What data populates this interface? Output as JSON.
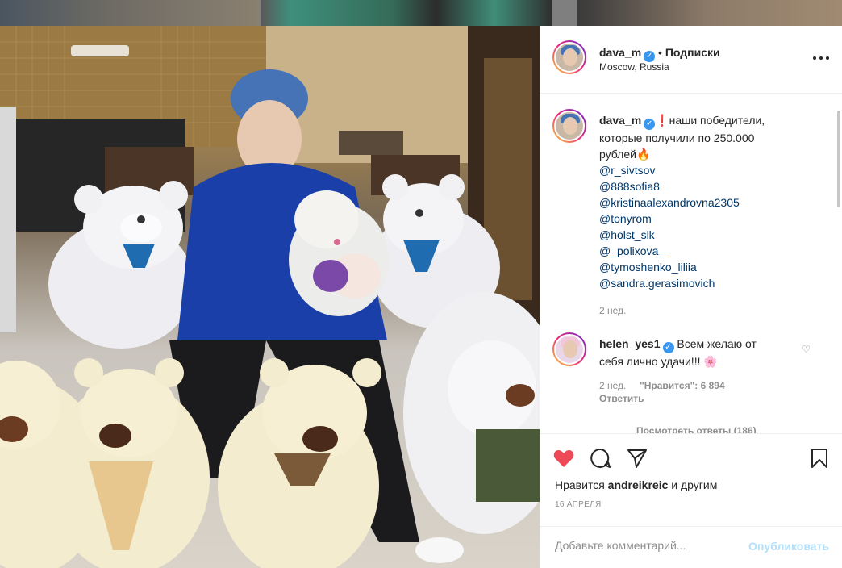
{
  "post": {
    "username": "dava_m",
    "follow_separator": "•",
    "follow_label": "Подписки",
    "location": "Moscow, Russia"
  },
  "caption": {
    "username": "dava_m",
    "text_line1": "❗наши победители,",
    "text_line2": "которые получили по 250.000",
    "text_line3": "рублей🔥",
    "mentions": [
      "@r_sivtsov",
      "@888sofia8",
      "@kristinaalexandrovna2305",
      "@tonyrom",
      "@holst_slk",
      "@_polixova_",
      "@tymoshenko_liliia",
      "@sandra.gerasimovich"
    ],
    "time": "2 нед."
  },
  "comment": {
    "username": "helen_yes1",
    "text_line1": "Всем желаю от",
    "text_line2": "себя лично удачи!!! 🌸",
    "time": "2 нед.",
    "likes_label": "\"Нравится\": 6 894",
    "reply_label": "Ответить",
    "view_replies": "Посмотреть ответы (186)"
  },
  "actions": {
    "likes_prefix": "Нравится",
    "likes_user": "andreikreic",
    "likes_suffix": "и другим",
    "date": "16 АПРЕЛЯ"
  },
  "add_comment": {
    "placeholder": "Добавьте комментарий...",
    "publish_label": "Опубликовать"
  },
  "icons": {
    "like": "heart-filled-icon",
    "comment": "comment-bubble-icon",
    "share": "paper-plane-icon",
    "save": "bookmark-icon",
    "more": "more-dots-icon",
    "verified": "verified-badge-icon"
  },
  "colors": {
    "like_red": "#ed4956",
    "link_blue": "#00376b",
    "verified_blue": "#3897f0",
    "publish_disabled": "#b2dffc",
    "muted": "#8e8e8e"
  }
}
